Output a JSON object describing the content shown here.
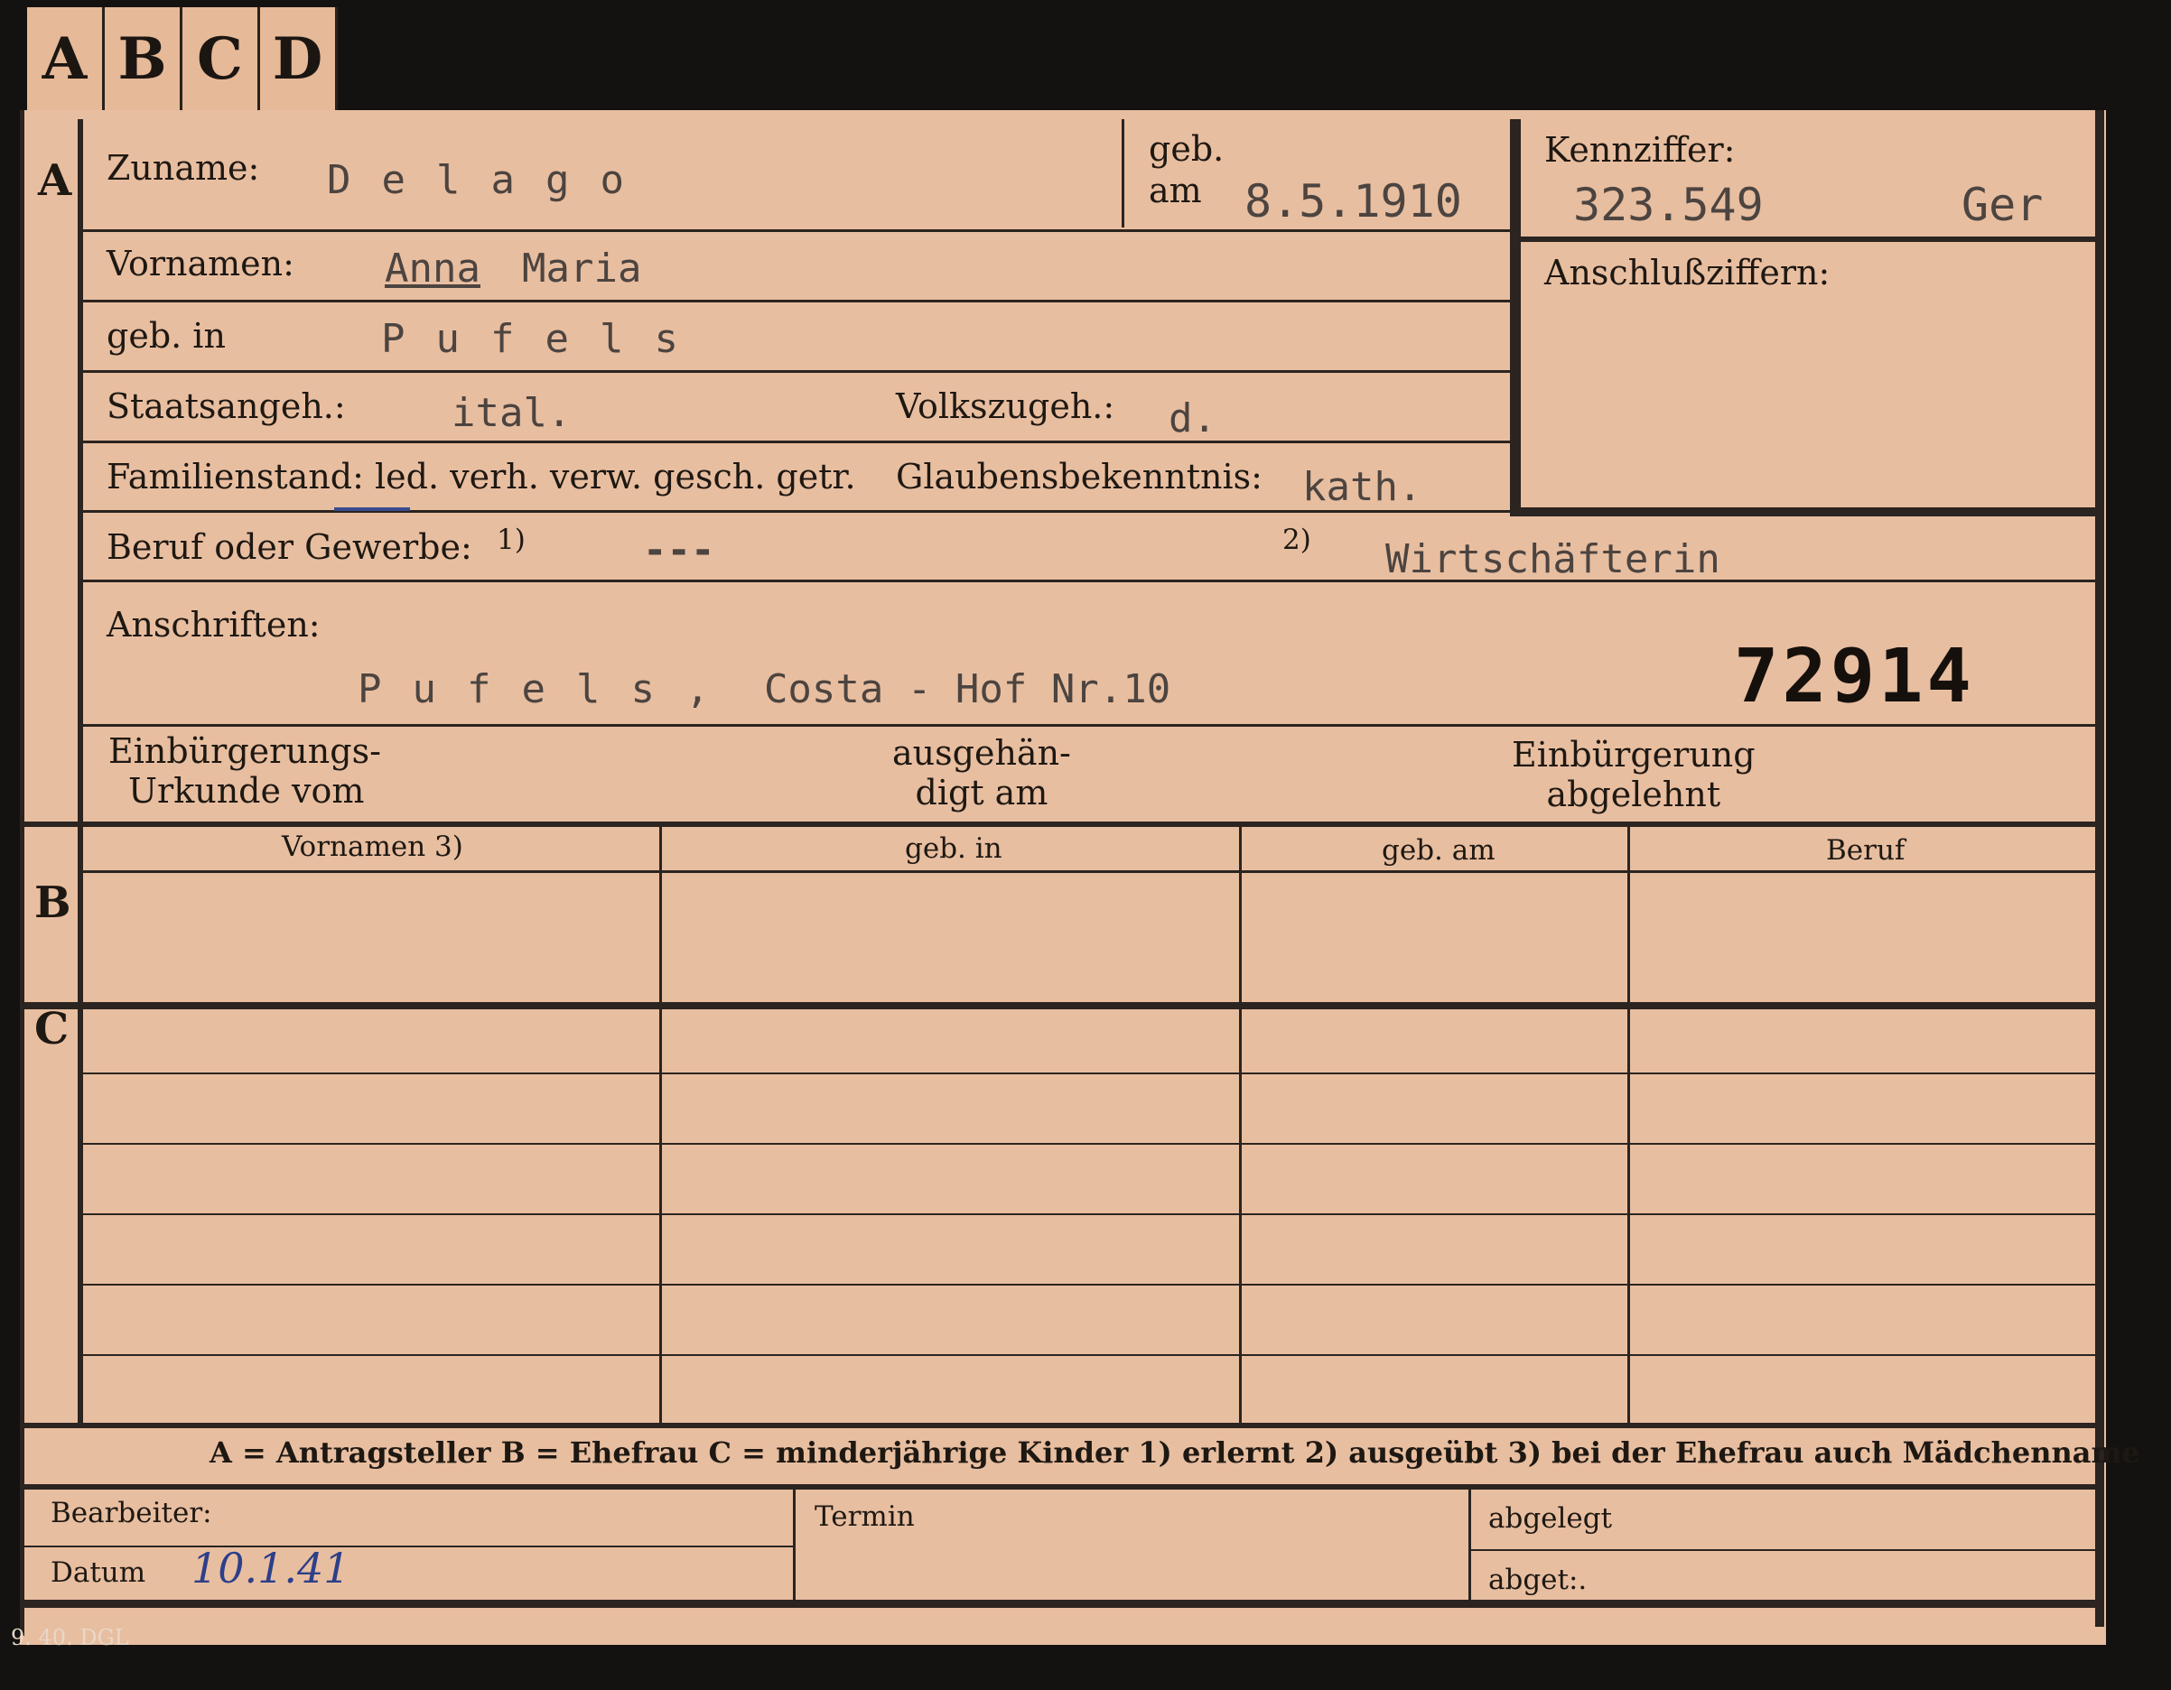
{
  "tabs": [
    "A",
    "B",
    "C",
    "D"
  ],
  "sections": {
    "a": "A",
    "b": "B",
    "c": "C"
  },
  "fields": {
    "surname_label": "Zuname:",
    "surname_value": "Delago",
    "born_label_line1": "geb.",
    "born_label_line2": "am",
    "born_value": "8.5.1910",
    "reference_label": "Kennziffer:",
    "reference_value": "323.549",
    "reference_suffix": "Ger",
    "linked_numbers_label": "Anschlußziffern:",
    "given_names_label": "Vornamen:",
    "given_names_value_underlined": "Anna",
    "given_names_value_rest": "Maria",
    "birthplace_label": "geb. in",
    "birthplace_value": "Pufels",
    "citizenship_label": "Staatsangeh.:",
    "citizenship_value": "ital.",
    "ethnicity_label": "Volkszugeh.:",
    "ethnicity_value": "d.",
    "marital_status_label": "Familienstand: led. verh. verw. gesch. getr.",
    "religion_label": "Glaubensbekenntnis:",
    "religion_value": "kath.",
    "occupation_label": "Beruf oder Gewerbe:",
    "occupation_note1": "1)",
    "occupation_value1": "---",
    "occupation_note2": "2)",
    "occupation_value2": "Wirtschäfterin",
    "addresses_label": "Anschriften:",
    "address_value_spaced": "Pufels,",
    "address_value_rest": "Costa - Hof Nr.10",
    "stamp_number": "72914",
    "naturalization_cert_line1": "Einbürgerungs-",
    "naturalization_cert_line2": "Urkunde vom",
    "handed_out_line1": "ausgehän-",
    "handed_out_line2": "digt am",
    "naturalization_denied_line1": "Einbürgerung",
    "naturalization_denied_line2": "abgelehnt"
  },
  "table_headers": [
    "Vornamen 3)",
    "geb. in",
    "geb. am",
    "Beruf"
  ],
  "legend": "A = Antragsteller   B = Ehefrau   C = minderjährige Kinder   1) erlernt   2) ausgeübt   3) bei der Ehefrau auch Mädchenname",
  "bottom": {
    "clerk_label": "Bearbeiter:",
    "date_label": "Datum",
    "date_value": "10.1.41",
    "deadline_label": "Termin",
    "filed_label": "abgelegt",
    "filed2_label": "abget:."
  },
  "print_code": "9. 40. DGL"
}
